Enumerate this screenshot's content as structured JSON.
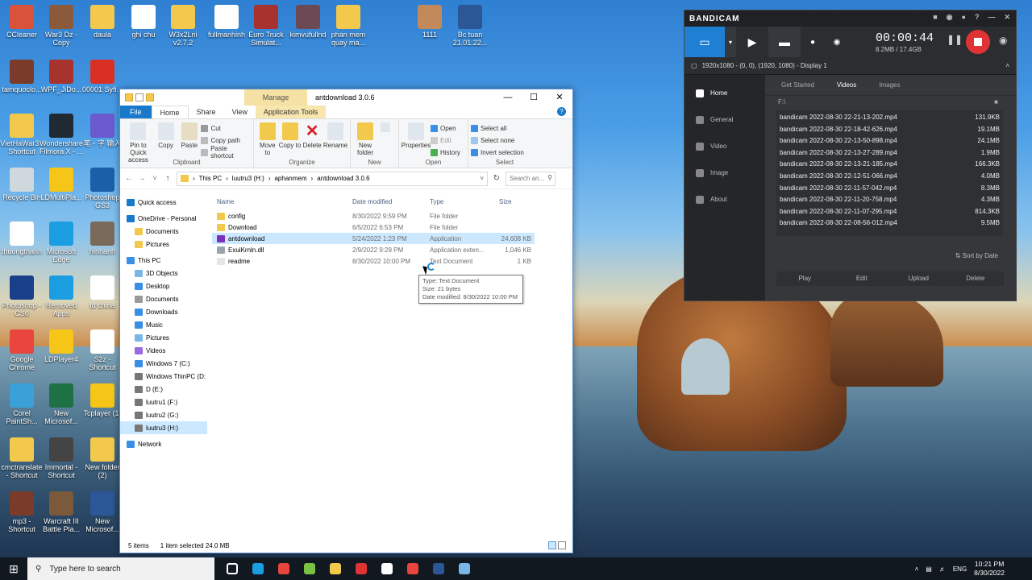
{
  "desktop": {
    "icons": [
      {
        "label": "CCleaner",
        "color": "#d9533b",
        "icon": "ccleaner-icon"
      },
      {
        "label": "War3 Dz - Copy",
        "color": "#8a5a3a",
        "icon": "war3-icon"
      },
      {
        "label": "daula",
        "color": "#f2c94c",
        "icon": "folder-icon"
      },
      {
        "label": "ghi chu",
        "color": "#ffffff",
        "icon": "text-file-icon"
      },
      {
        "label": "W3x2Lni v2.7.2",
        "color": "#f2c94c",
        "icon": "folder-icon"
      },
      {
        "label": "fullmanhinh",
        "color": "#ffffff",
        "icon": "document-icon"
      },
      {
        "label": "Euro Truck Simulat...",
        "color": "#a8322e",
        "icon": "winrar-icon"
      },
      {
        "label": "kimvufullnd",
        "color": "#6b4a55",
        "icon": "game-icon"
      },
      {
        "label": "phan mem quay ma...",
        "color": "#f2c94c",
        "icon": "folder-icon"
      },
      {
        "label": "1111",
        "color": "#c28a5a",
        "icon": "image-icon"
      },
      {
        "label": "Bc tuan 21.01.22...",
        "color": "#2b5797",
        "icon": "word-icon"
      },
      {
        "label": "tamquoclo...",
        "color": "#7a3b2a",
        "icon": "game-icon"
      },
      {
        "label": "WPF_JiDo...",
        "color": "#a8322e",
        "icon": "winrar-icon"
      },
      {
        "label": "00001 Syfi...",
        "color": "#d93025",
        "icon": "pdf-icon"
      },
      {
        "label": "VietHaWar3 - Shortcut",
        "color": "#f2c94c",
        "icon": "folder-icon"
      },
      {
        "label": "Wondershare Filmora X - ...",
        "color": "#1f2a33",
        "icon": "filmora-icon"
      },
      {
        "label": "笔 - 字 输入",
        "color": "#6a5acd",
        "icon": "pen-icon"
      },
      {
        "label": "Recycle Bin",
        "color": "#cfd8dc",
        "icon": "recycle-bin-icon"
      },
      {
        "label": "LDMultiPla...",
        "color": "#f5c518",
        "icon": "ldplayer-icon"
      },
      {
        "label": "Photoshop GS3",
        "color": "#1a5fa8",
        "icon": "photoshop-icon"
      },
      {
        "label": "thuongthanh",
        "color": "#ffffff",
        "icon": "text-file-icon"
      },
      {
        "label": "Microsoft Edge",
        "color": "#1b9de2",
        "icon": "edge-icon"
      },
      {
        "label": "hinhanh",
        "color": "#7a6a5a",
        "icon": "image-icon"
      },
      {
        "label": "Photoshop - CS6",
        "color": "#1a3f8a",
        "icon": "photoshop-icon"
      },
      {
        "label": "Removed Apps",
        "color": "#1b9de2",
        "icon": "edge-icon"
      },
      {
        "label": "td china",
        "color": "#ffffff",
        "icon": "text-file-icon"
      },
      {
        "label": "Google Chrome",
        "color": "#e8453c",
        "icon": "chrome-icon"
      },
      {
        "label": "LDPlayer4",
        "color": "#f5c518",
        "icon": "ldplayer-icon"
      },
      {
        "label": "S2z - Shortcut",
        "color": "#ffffff",
        "icon": "text-file-icon"
      },
      {
        "label": "Corel PaintSh...",
        "color": "#3aa0d8",
        "icon": "corel-icon"
      },
      {
        "label": "New Microsof...",
        "color": "#1e7145",
        "icon": "excel-icon"
      },
      {
        "label": "Tcplayer (1)",
        "color": "#f5c518",
        "icon": "tcplayer-icon"
      },
      {
        "label": "cmctranslate - Shortcut",
        "color": "#f2c94c",
        "icon": "folder-icon"
      },
      {
        "label": "Immortal - Shortcut",
        "color": "#444444",
        "icon": "game-icon"
      },
      {
        "label": "New folder (2)",
        "color": "#f2c94c",
        "icon": "folder-icon"
      },
      {
        "label": "mp3 - Shortcut",
        "color": "#7a3b2a",
        "icon": "game-icon"
      },
      {
        "label": "Warcraft III Battle Pla...",
        "color": "#7a5a3a",
        "icon": "warcraft-icon"
      },
      {
        "label": "New Microsof...",
        "color": "#2b5797",
        "icon": "word-icon"
      }
    ]
  },
  "explorer": {
    "title": "antdownload 3.0.6",
    "manage_tab": "Manage",
    "tabs": [
      "File",
      "Home",
      "Share",
      "View",
      "Application Tools"
    ],
    "ribbon": {
      "clipboard": {
        "group": "Clipboard",
        "pin": "Pin to Quick access",
        "copy": "Copy",
        "paste": "Paste",
        "cut": "Cut",
        "copy_path": "Copy path",
        "paste_shortcut": "Paste shortcut"
      },
      "organize": {
        "group": "Organize",
        "move_to": "Move to",
        "copy_to": "Copy to",
        "delete": "Delete",
        "rename": "Rename"
      },
      "new": {
        "group": "New",
        "new_folder": "New folder"
      },
      "open": {
        "group": "Open",
        "properties": "Properties",
        "open": "Open",
        "edit": "Edit",
        "history": "History"
      },
      "select": {
        "group": "Select",
        "select_all": "Select all",
        "select_none": "Select none",
        "invert": "Invert selection"
      }
    },
    "address": {
      "segments": [
        "This PC",
        "luutru3 (H:)",
        "aphanmem",
        "antdownload 3.0.6"
      ],
      "search_placeholder": "Search an..."
    },
    "nav": [
      {
        "label": "Quick access",
        "color": "#1979ca",
        "icon": "star-icon",
        "indent": 0
      },
      {
        "label": "OneDrive - Personal",
        "color": "#1979ca",
        "icon": "cloud-icon",
        "indent": 0
      },
      {
        "label": "Documents",
        "color": "#f2c94c",
        "icon": "folder-icon",
        "indent": 1
      },
      {
        "label": "Pictures",
        "color": "#f2c94c",
        "icon": "folder-icon",
        "indent": 1
      },
      {
        "label": "This PC",
        "color": "#3a8ee6",
        "icon": "computer-icon",
        "indent": 0
      },
      {
        "label": "3D Objects",
        "color": "#7ab6e6",
        "icon": "cube-icon",
        "indent": 1
      },
      {
        "label": "Desktop",
        "color": "#3a8ee6",
        "icon": "desktop-icon",
        "indent": 1
      },
      {
        "label": "Documents",
        "color": "#9a9a9a",
        "icon": "documents-icon",
        "indent": 1
      },
      {
        "label": "Downloads",
        "color": "#3a8ee6",
        "icon": "download-icon",
        "indent": 1
      },
      {
        "label": "Music",
        "color": "#3a8ee6",
        "icon": "music-icon",
        "indent": 1
      },
      {
        "label": "Pictures",
        "color": "#7ab6e6",
        "icon": "pictures-icon",
        "indent": 1
      },
      {
        "label": "Videos",
        "color": "#9a6adf",
        "icon": "videos-icon",
        "indent": 1
      },
      {
        "label": "Windows 7 (C:)",
        "color": "#3a8ee6",
        "icon": "drive-icon",
        "indent": 1
      },
      {
        "label": "Windows ThinPC (D:",
        "color": "#777777",
        "icon": "drive-icon",
        "indent": 1
      },
      {
        "label": "D (E:)",
        "color": "#777777",
        "icon": "drive-icon",
        "indent": 1
      },
      {
        "label": "luutru1 (F:)",
        "color": "#777777",
        "icon": "drive-icon",
        "indent": 1
      },
      {
        "label": "luutru2 (G:)",
        "color": "#777777",
        "icon": "drive-icon",
        "indent": 1
      },
      {
        "label": "luutru3 (H:)",
        "color": "#777777",
        "icon": "drive-icon",
        "indent": 1,
        "selected": true
      },
      {
        "label": "Network",
        "color": "#3a8ee6",
        "icon": "network-icon",
        "indent": 0
      }
    ],
    "columns": [
      "Name",
      "Date modified",
      "Type",
      "Size"
    ],
    "files": [
      {
        "name": "config",
        "date": "8/30/2022 9:59 PM",
        "type": "File folder",
        "size": "",
        "color": "#f2c94c",
        "icon": "folder-icon"
      },
      {
        "name": "Download",
        "date": "6/5/2022 6:53 PM",
        "type": "File folder",
        "size": "",
        "color": "#f2c94c",
        "icon": "folder-icon"
      },
      {
        "name": "antdownload",
        "date": "5/24/2022 1:23 PM",
        "type": "Application",
        "size": "24,608 KB",
        "color": "#7b2fbf",
        "icon": "app-download-icon",
        "selected": true
      },
      {
        "name": "ExuiKrnln.dll",
        "date": "2/9/2022 9:29 PM",
        "type": "Application exten...",
        "size": "1,046 KB",
        "color": "#9aa4b0",
        "icon": "dll-icon"
      },
      {
        "name": "readme",
        "date": "8/30/2022 10:00 PM",
        "type": "Text Document",
        "size": "1 KB",
        "color": "#e6e6e6",
        "icon": "text-file-icon"
      }
    ],
    "tooltip": [
      "Type: Text Document",
      "Size: 21 bytes",
      "Date modified: 8/30/2022 10:00 PM"
    ],
    "status": {
      "count": "5 items",
      "selected": "1 item selected 24.0 MB"
    }
  },
  "bandicam": {
    "logo": "BANDICAM",
    "timer": "00:00:44",
    "size": "8.2MB / 17.4GB",
    "display_info": "1920x1080 - (0, 0), (1920, 1080) - Display 1",
    "sidebar": [
      "Home",
      "General",
      "Video",
      "Image",
      "About"
    ],
    "tabs": [
      "Get Started",
      "Videos",
      "Images"
    ],
    "path": "F:\\",
    "files": [
      {
        "name": "bandicam 2022-08-30 22-21-13-202.mp4",
        "size": "131.9KB"
      },
      {
        "name": "bandicam 2022-08-30 22-18-42-626.mp4",
        "size": "19.1MB"
      },
      {
        "name": "bandicam 2022-08-30 22-13-50-898.mp4",
        "size": "24.1MB"
      },
      {
        "name": "bandicam 2022-08-30 22-13-27-289.mp4",
        "size": "1.9MB"
      },
      {
        "name": "bandicam 2022-08-30 22-13-21-185.mp4",
        "size": "166.3KB"
      },
      {
        "name": "bandicam 2022-08-30 22-12-51-066.mp4",
        "size": "4.0MB"
      },
      {
        "name": "bandicam 2022-08-30 22-11-57-042.mp4",
        "size": "8.3MB"
      },
      {
        "name": "bandicam 2022-08-30 22-11-20-758.mp4",
        "size": "4.3MB"
      },
      {
        "name": "bandicam 2022-08-30 22-11-07-295.mp4",
        "size": "814.3KB"
      },
      {
        "name": "bandicam 2022-08-30 22-08-56-012.mp4",
        "size": "9.5MB"
      }
    ],
    "sort": "Sort by Date",
    "actions": [
      "Play",
      "Edit",
      "Upload",
      "Delete"
    ]
  },
  "taskbar": {
    "search_placeholder": "Type here to search",
    "language": "ENG",
    "time": "10:21 PM",
    "date": "8/30/2022",
    "pinned": [
      {
        "icon": "task-view-icon",
        "color": "#ffffff"
      },
      {
        "icon": "edge-icon",
        "color": "#1b9de2"
      },
      {
        "icon": "chrome-icon",
        "color": "#e8453c"
      },
      {
        "icon": "app-icon",
        "color": "#7cc242"
      },
      {
        "icon": "file-explorer-icon",
        "color": "#f2c94c"
      },
      {
        "icon": "bandicam-icon",
        "color": "#e03434"
      },
      {
        "icon": "app-icon",
        "color": "#ffffff"
      },
      {
        "icon": "chrome-icon",
        "color": "#e8453c"
      },
      {
        "icon": "word-icon",
        "color": "#2b5797"
      },
      {
        "icon": "app-icon",
        "color": "#7ab6e6"
      }
    ]
  }
}
